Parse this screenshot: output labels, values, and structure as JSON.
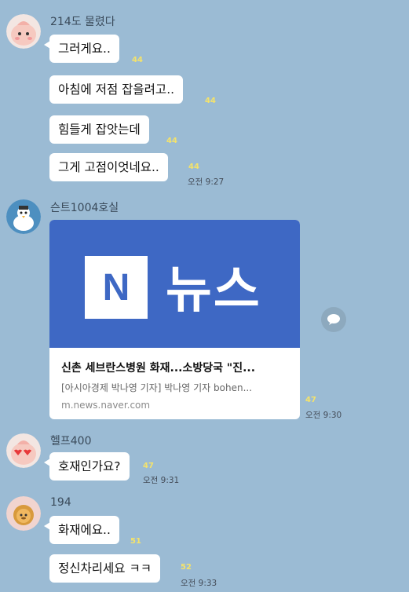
{
  "messages_group1": {
    "sender": "214도 물렸다",
    "bubbles": [
      "그러게요..",
      "아침에 저점 잡을려고..",
      "힘들게 잡앗는데",
      "그게 고점이엇네요.."
    ],
    "unread": [
      "44",
      "44",
      "44",
      "44"
    ],
    "time": "오전 9:27"
  },
  "messages_group2": {
    "sender": "슨트1004호실",
    "card": {
      "banner_mark": "N",
      "banner_word": "뉴스",
      "title": "신촌 세브란스병원 화재...소방당국 \"진...",
      "desc": "[아시아경제 박나영 기자] 박나영 기자 bohen...",
      "url": "m.news.naver.com"
    },
    "unread": "47",
    "time": "오전 9:30"
  },
  "messages_group3": {
    "sender": "헬프400",
    "bubble": "호재인가요?",
    "unread": "47",
    "time": "오전 9:31"
  },
  "messages_group4": {
    "sender": "194",
    "bubbles": [
      "화재에요..",
      "정신차리세요 ㅋㅋ"
    ],
    "unread": [
      "51",
      "52"
    ],
    "time": "오전 9:33"
  },
  "colors": {
    "background": "#9bbbd4",
    "bubble": "#ffffff",
    "unread": "#f5e36a",
    "naver_blue": "#3e68c4"
  }
}
